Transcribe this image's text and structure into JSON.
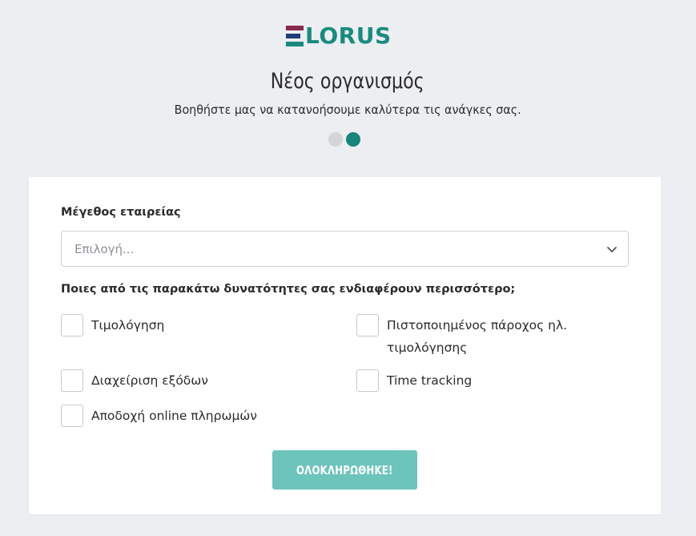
{
  "brand": {
    "name": "LORUS",
    "colors": {
      "maroon": "#8a2a4a",
      "navy": "#1f3e73",
      "teal": "#1a8a80"
    }
  },
  "header": {
    "title": "Νέος οργανισμός",
    "subtitle": "Βοηθήστε μας να κατανοήσουμε καλύτερα τις ανάγκες σας."
  },
  "steps": {
    "total": 2,
    "current": 2
  },
  "form": {
    "company_size": {
      "label": "Μέγεθος εταιρείας",
      "placeholder": "Επιλογή..."
    },
    "features": {
      "label": "Ποιες από τις παρακάτω δυνατότητες σας ενδιαφέρουν περισσότερο;",
      "options": [
        {
          "label": "Τιμολόγηση",
          "checked": false
        },
        {
          "label": "Πιστοποιημένος πάροχος ηλ. τιμολόγησης",
          "checked": false
        },
        {
          "label": "Διαχείριση εξόδων",
          "checked": false
        },
        {
          "label": "Time tracking",
          "checked": false
        },
        {
          "label": "Αποδοχή online πληρωμών",
          "checked": false
        }
      ]
    },
    "submit_label": "ΟΛΟΚΛΗΡΩΘΗΚΕ!",
    "submit_color": "#6cc4bc"
  },
  "icons": {
    "select_arrow": "chevron-down-icon"
  }
}
